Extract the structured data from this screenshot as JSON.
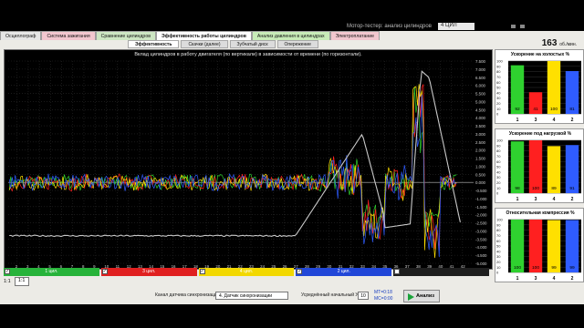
{
  "window": {
    "title_label": "Мотор-тестер: анализ цилиндров",
    "title_value": "4 ЦИЛ"
  },
  "tabs": [
    {
      "label": "Осциллограф",
      "color": "#e6e6e6"
    },
    {
      "label": "Система зажигания",
      "color": "#f2c7cf"
    },
    {
      "label": "Сравнение цилиндров",
      "color": "#cde6c3"
    },
    {
      "label": "Эффективность работы цилиндров",
      "color": "#ffffff",
      "active": true
    },
    {
      "label": "Анализ давления в цилиндрах",
      "color": "#c8ecb8"
    },
    {
      "label": "Электроплатание",
      "color": "#f2c7cf"
    }
  ],
  "subtabs": [
    {
      "label": "Эффективность",
      "active": true
    },
    {
      "label": "Скачки (далее)"
    },
    {
      "label": "Зубчатый диск"
    },
    {
      "label": "Опережение"
    }
  ],
  "rpm": {
    "value": "163",
    "unit": "об./мин."
  },
  "chart_data": {
    "type": "line",
    "title": "Вклад цилиндров в работу двигателя (по вертикали) в зависимости от времени (по горизонтали).",
    "xlabel": "",
    "ylabel": "",
    "x_ticks": [
      2,
      3,
      4,
      5,
      6,
      7,
      8,
      9,
      10,
      11,
      12,
      13,
      14,
      15,
      16,
      17,
      18,
      19,
      20,
      21,
      22,
      23,
      24,
      25,
      26,
      27,
      28,
      29,
      30,
      31,
      32,
      33,
      34,
      35,
      36,
      37,
      38,
      39,
      40,
      41,
      42
    ],
    "y_ticks": [
      "-5.000",
      "-4.500",
      "-4.000",
      "-3.500",
      "-3.000",
      "-2.500",
      "-2.000",
      "-1.500",
      "-1.000",
      "-0.500",
      "0.000",
      "0.500",
      "1.000",
      "1.500",
      "2.000",
      "2.500",
      "3.000",
      "3.500",
      "4.000",
      "4.500",
      "5.000",
      "5.500",
      "6.000",
      "6.500",
      "7.000",
      "7.500"
    ],
    "ylim": [
      -5.0,
      7.5
    ],
    "grid": true,
    "series": [
      {
        "name": "1 цил.",
        "color": "#2fd12f"
      },
      {
        "name": "3 цил.",
        "color": "#ff2020"
      },
      {
        "name": "4 цил.",
        "color": "#ffe000"
      },
      {
        "name": "2 цил.",
        "color": "#2f5cff"
      },
      {
        "name": "",
        "color": "#c8c8c8"
      }
    ]
  },
  "mini_charts": [
    {
      "title": "Ускорение на холостых %",
      "categories": [
        "1",
        "3",
        "4",
        "2"
      ],
      "values": [
        92,
        41,
        100,
        81
      ],
      "colors": [
        "#2fd12f",
        "#ff2020",
        "#ffe000",
        "#2f5cff"
      ],
      "y_ticks": [
        "100",
        "90",
        "80",
        "70",
        "60",
        "50",
        "40",
        "30",
        "20",
        "10",
        "0"
      ]
    },
    {
      "title": "Ускорение под нагрузкой %",
      "categories": [
        "1",
        "3",
        "4",
        "2"
      ],
      "values": [
        98,
        100,
        89,
        91
      ],
      "colors": [
        "#2fd12f",
        "#ff2020",
        "#ffe000",
        "#2f5cff"
      ],
      "y_ticks": [
        "100",
        "90",
        "80",
        "70",
        "60",
        "50",
        "40",
        "30",
        "20",
        "10",
        "0"
      ]
    },
    {
      "title": "Относительная компрессия %",
      "categories": [
        "1",
        "3",
        "4",
        "2"
      ],
      "values": [
        100,
        100,
        99,
        99
      ],
      "colors": [
        "#2fd12f",
        "#ff2020",
        "#ffe000",
        "#2f5cff"
      ],
      "y_ticks": [
        "100",
        "90",
        "80",
        "70",
        "60",
        "50",
        "40",
        "30",
        "20",
        "10",
        "0"
      ]
    }
  ],
  "legend": [
    {
      "label": "1 цил.",
      "color": "#27b33a",
      "checked": true
    },
    {
      "label": "3 цил.",
      "color": "#e02020",
      "checked": true
    },
    {
      "label": "4 цил.",
      "color": "#f2d800",
      "checked": true
    },
    {
      "label": "2 цил.",
      "color": "#2147d8",
      "checked": true
    },
    {
      "label": "",
      "color": "#1e1e1e",
      "checked": false
    }
  ],
  "scale": {
    "label": "1:1",
    "value": "1:1"
  },
  "controls": {
    "sync_label": "Канал датчика синхронизации",
    "sync_value": "4. Датчик синхронизации",
    "uoz_label": "Усреднённый начальный УОЗ",
    "uoz_value": "10",
    "mt1": "МТ=0:18",
    "mt2": "МС=0:00",
    "analyze_label": "Анализ"
  }
}
